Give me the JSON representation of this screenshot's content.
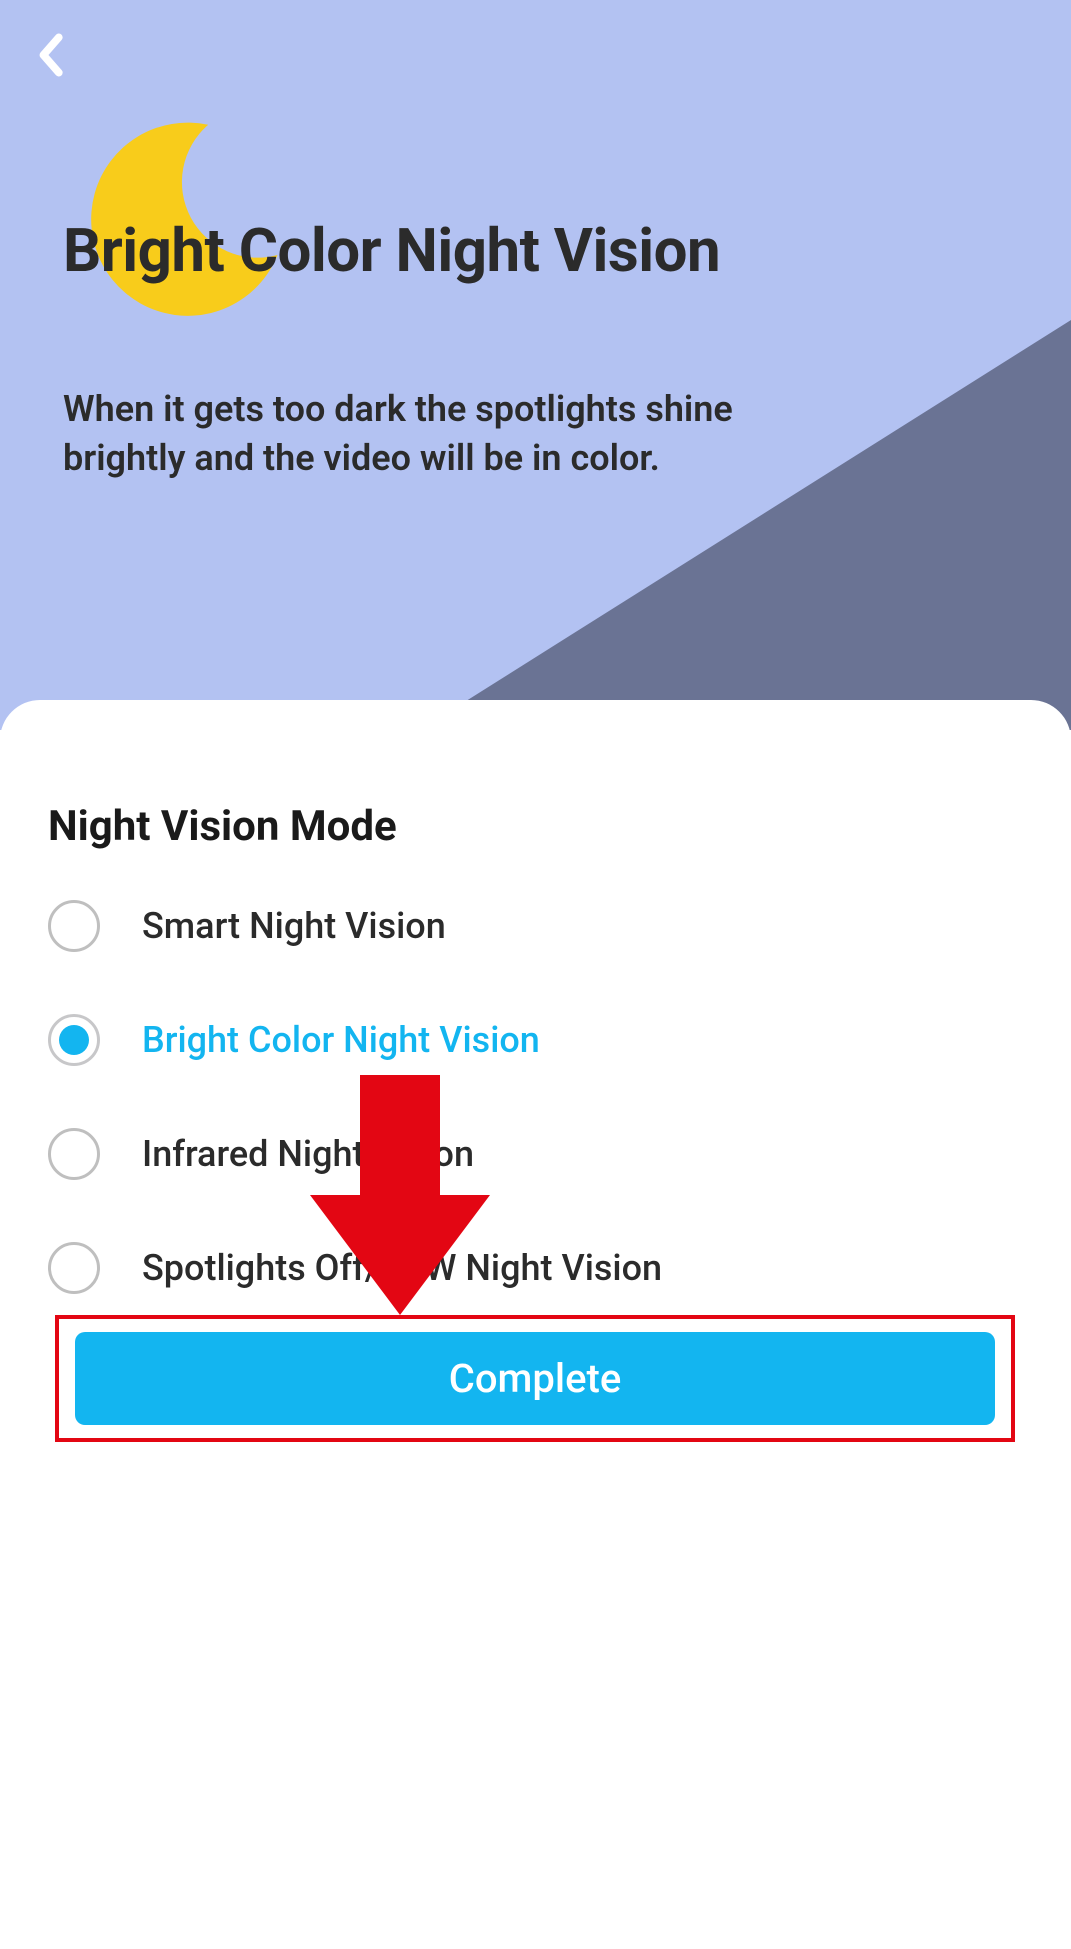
{
  "hero": {
    "title": "Bright Color Night Vision",
    "description": "When it gets too dark the spotlights shine brightly and the video will be in color."
  },
  "sheet": {
    "title": "Night Vision Mode",
    "options": [
      {
        "label": "Smart Night Vision",
        "selected": false
      },
      {
        "label": "Bright Color Night Vision",
        "selected": true
      },
      {
        "label": "Infrared Night Vision",
        "selected": false
      },
      {
        "label": "Spotlights Off/B&W Night Vision",
        "selected": false
      }
    ],
    "complete_label": "Complete"
  },
  "annotation": {
    "highlight": "complete-button",
    "arrow_points_to": "complete-button"
  },
  "colors": {
    "hero_bg": "#B3C2F2",
    "hero_shade": "#6A7394",
    "moon": "#F8CC1B",
    "accent": "#13b5f0",
    "annotation": "#e30613"
  }
}
